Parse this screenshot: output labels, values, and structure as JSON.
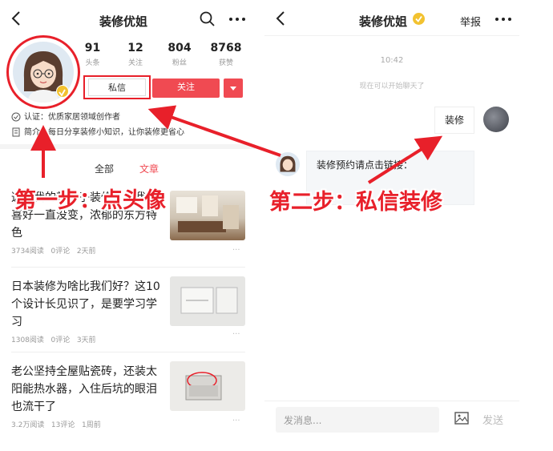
{
  "left": {
    "title": "装修优姐",
    "stats": [
      {
        "num": "91",
        "label": "头条"
      },
      {
        "num": "12",
        "label": "关注"
      },
      {
        "num": "804",
        "label": "粉丝"
      },
      {
        "num": "8768",
        "label": "获赞"
      }
    ],
    "message_button": "私信",
    "follow_button": "关注",
    "verify_text": "认证：优质家居领域创作者",
    "intro_text": "简介：每日分享装修小知识，让你装修更省心",
    "tabs": {
      "all": "全部",
      "article": "文章"
    },
    "articles": [
      {
        "title": "这次我的新房子装修，但我的喜好一直没变，浓郁的东方特色",
        "reads": "3734阅读",
        "comments": "0评论",
        "time": "2天前"
      },
      {
        "title": "日本装修为啥比我们好？这10个设计长见识了，是要学习学习",
        "reads": "1308阅读",
        "comments": "0评论",
        "time": "3天前"
      },
      {
        "title": "老公坚持全屋贴瓷砖，还装太阳能热水器，入住后坑的眼泪也流干了",
        "reads": "3.2万阅读",
        "comments": "13评论",
        "time": "1周前"
      }
    ]
  },
  "right": {
    "title": "装修优姐",
    "report": "举报",
    "time": "10:42",
    "note": "现在可以开始聊天了",
    "sent_message": "装修",
    "reply_message": "装修预约请点击链接：",
    "input_placeholder": "发消息...",
    "send_button": "发送"
  },
  "annotations": {
    "step1": "第一步：点头像",
    "step2": "第二步：私信装修"
  },
  "colors": {
    "accent": "#f04a52",
    "annotation": "#e8202a"
  }
}
